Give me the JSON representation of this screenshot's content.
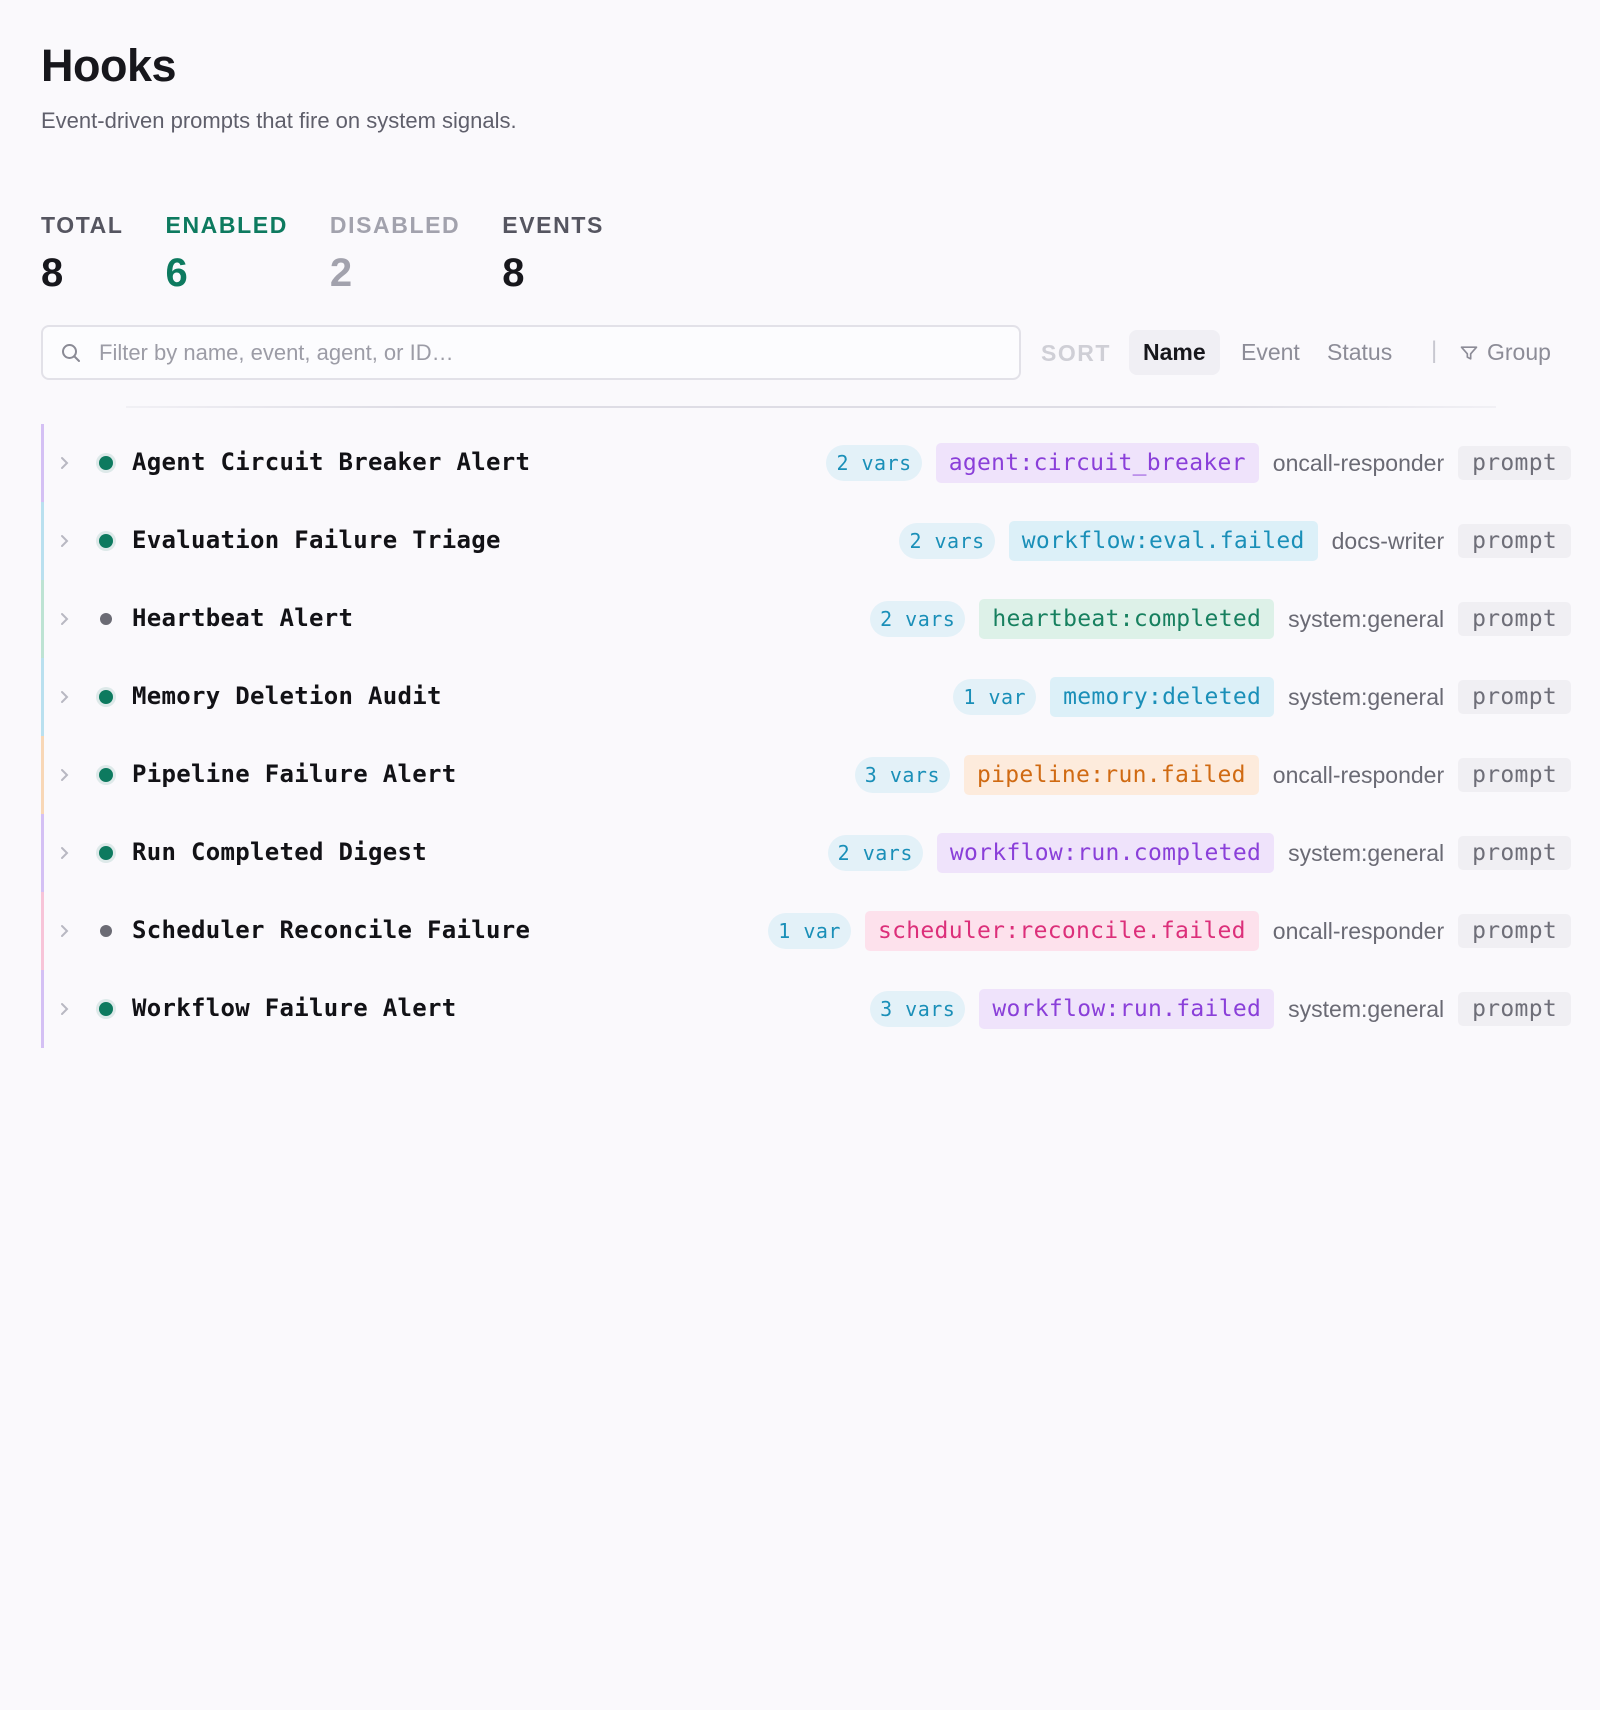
{
  "page": {
    "title": "Hooks",
    "subtitle": "Event-driven prompts that fire on system signals."
  },
  "stats": {
    "total": {
      "label": "TOTAL",
      "value": "8"
    },
    "enabled": {
      "label": "ENABLED",
      "value": "6"
    },
    "disabled": {
      "label": "DISABLED",
      "value": "2"
    },
    "events": {
      "label": "EVENTS",
      "value": "8"
    }
  },
  "toolbar": {
    "search_placeholder": "Filter by name, event, agent, or ID…",
    "search_value": "",
    "sort_label": "SORT",
    "sort_options": [
      "Name",
      "Event",
      "Status"
    ],
    "sort_active": "Name",
    "divider": "|",
    "group_label": "Group"
  },
  "colors": {
    "enabled": "#0d7a5f",
    "disabled": "#6b6b74",
    "purple": "#8a3fd9",
    "blue": "#1a8fb8",
    "green": "#17805f",
    "orange": "#d06a12",
    "pink": "#dc2f7a"
  },
  "hooks": [
    {
      "name": "Agent Circuit Breaker Alert",
      "enabled": true,
      "vars": "2 vars",
      "event": "agent:circuit_breaker",
      "event_color": "purple",
      "agent": "oncall-responder",
      "kind": "prompt"
    },
    {
      "name": "Evaluation Failure Triage",
      "enabled": true,
      "vars": "2 vars",
      "event": "workflow:eval.failed",
      "event_color": "blue",
      "agent": "docs-writer",
      "kind": "prompt"
    },
    {
      "name": "Heartbeat Alert",
      "enabled": false,
      "vars": "2 vars",
      "event": "heartbeat:completed",
      "event_color": "green",
      "agent": "system:general",
      "kind": "prompt"
    },
    {
      "name": "Memory Deletion Audit",
      "enabled": true,
      "vars": "1 var",
      "event": "memory:deleted",
      "event_color": "blue",
      "agent": "system:general",
      "kind": "prompt"
    },
    {
      "name": "Pipeline Failure Alert",
      "enabled": true,
      "vars": "3 vars",
      "event": "pipeline:run.failed",
      "event_color": "orange",
      "agent": "oncall-responder",
      "kind": "prompt"
    },
    {
      "name": "Run Completed Digest",
      "enabled": true,
      "vars": "2 vars",
      "event": "workflow:run.completed",
      "event_color": "purple",
      "agent": "system:general",
      "kind": "prompt"
    },
    {
      "name": "Scheduler Reconcile Failure",
      "enabled": false,
      "vars": "1 var",
      "event": "scheduler:reconcile.failed",
      "event_color": "pink",
      "agent": "oncall-responder",
      "kind": "prompt"
    },
    {
      "name": "Workflow Failure Alert",
      "enabled": true,
      "vars": "3 vars",
      "event": "workflow:run.failed",
      "event_color": "purple",
      "agent": "system:general",
      "kind": "prompt"
    }
  ]
}
